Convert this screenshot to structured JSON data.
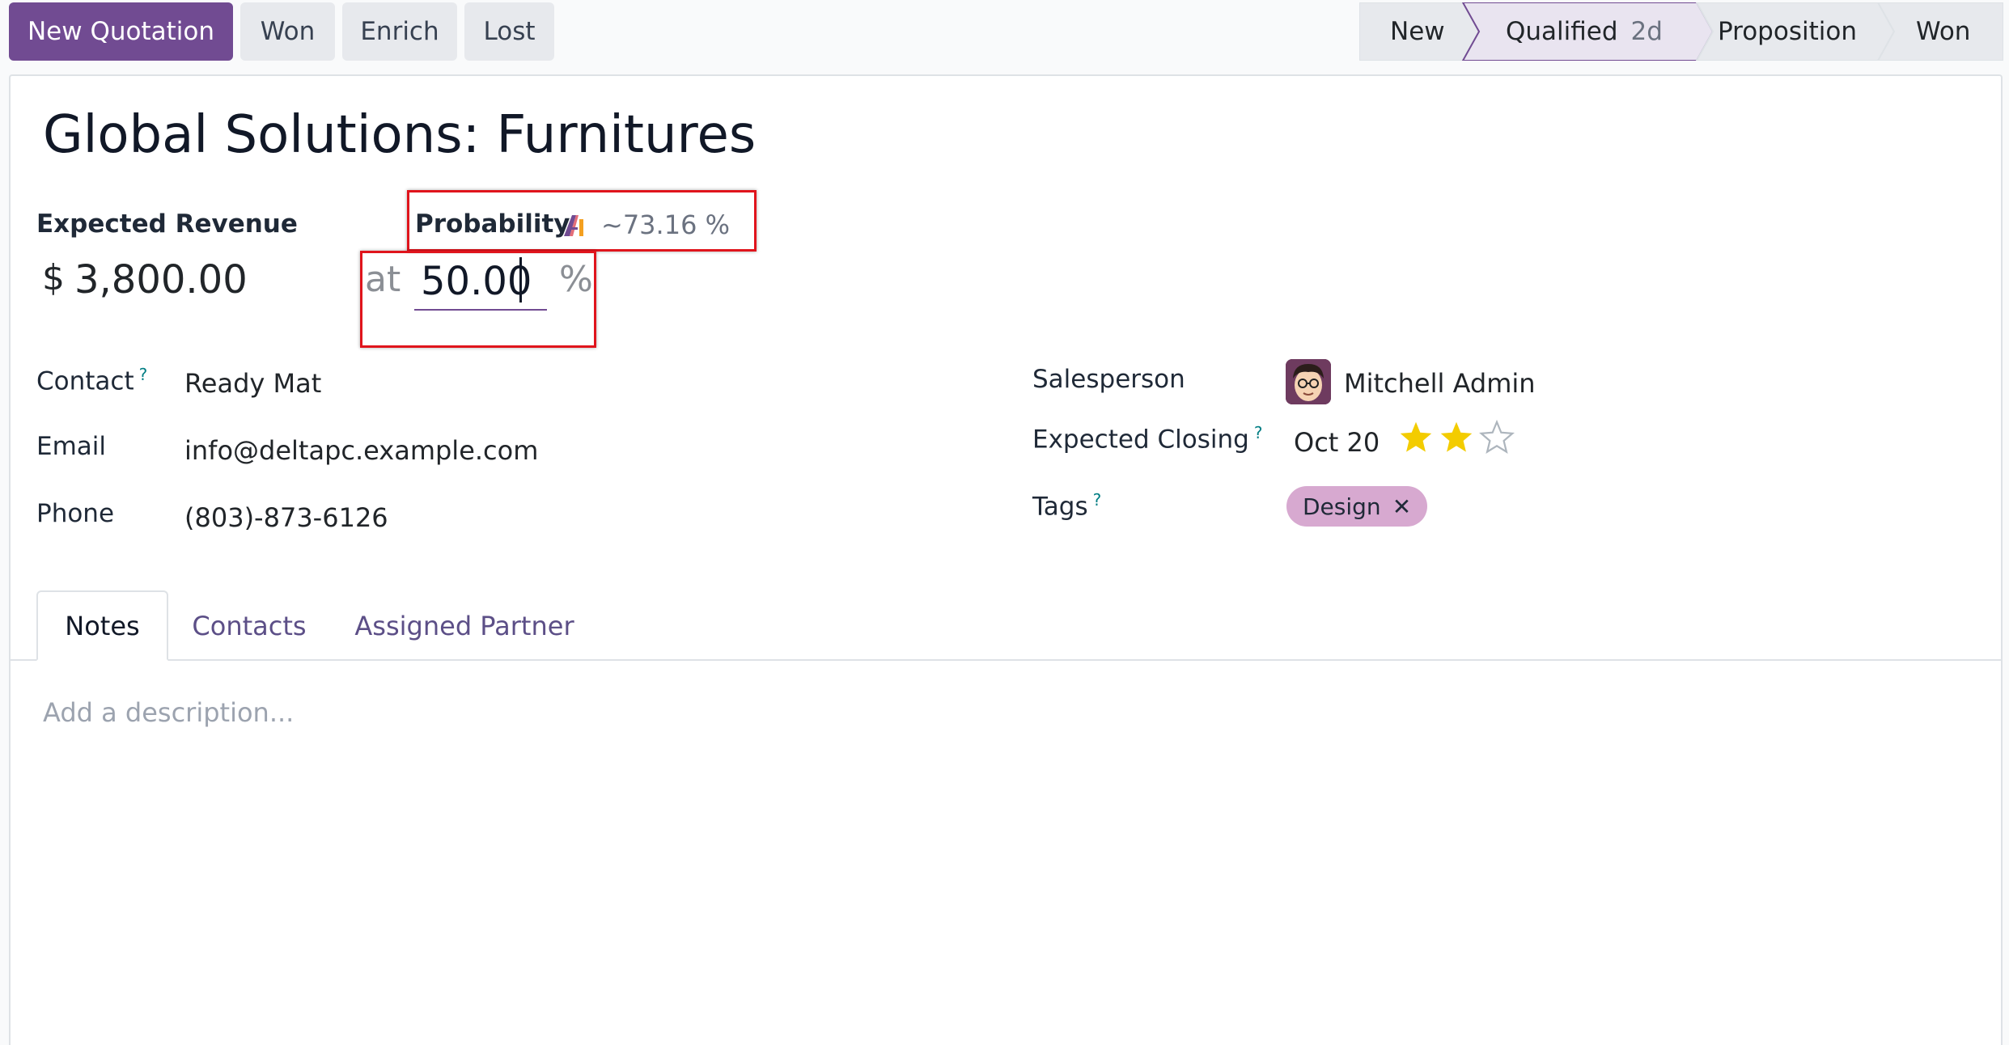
{
  "toolbar": {
    "new_quotation": "New Quotation",
    "won": "Won",
    "enrich": "Enrich",
    "lost": "Lost"
  },
  "pipeline": {
    "stages": [
      {
        "label": "New",
        "active": false
      },
      {
        "label": "Qualified",
        "duration": "2d",
        "active": true
      },
      {
        "label": "Proposition",
        "active": false
      },
      {
        "label": "Won",
        "active": false
      }
    ]
  },
  "lead": {
    "title": "Global Solutions: Furnitures",
    "expected_revenue_label": "Expected Revenue",
    "currency": "$",
    "expected_revenue": "3,800.00",
    "probability_label": "Probability",
    "ai_probability": "~73.16 %",
    "at_label": "at",
    "probability": "50.00",
    "percent_sign": "%"
  },
  "left_fields": {
    "contact_label": "Contact",
    "contact_help": "?",
    "contact": "Ready Mat",
    "email_label": "Email",
    "email": "info@deltapc.example.com",
    "phone_label": "Phone",
    "phone": "(803)-873-6126"
  },
  "right_fields": {
    "salesperson_label": "Salesperson",
    "salesperson": "Mitchell Admin",
    "expected_closing_label": "Expected Closing",
    "expected_closing_help": "?",
    "expected_closing": "Oct 20",
    "priority_stars": 2,
    "priority_max": 3,
    "tags_label": "Tags",
    "tags_help": "?",
    "tags": [
      "Design"
    ],
    "tag_remove": "✕"
  },
  "tabs": {
    "notes": "Notes",
    "contacts": "Contacts",
    "assigned_partner": "Assigned Partner"
  },
  "notes": {
    "placeholder": "Add a description..."
  },
  "colors": {
    "primary": "#714b92",
    "highlight_box": "#e0141c",
    "star_filled": "#f3cc00",
    "tag_bg": "#d7a9d0"
  }
}
